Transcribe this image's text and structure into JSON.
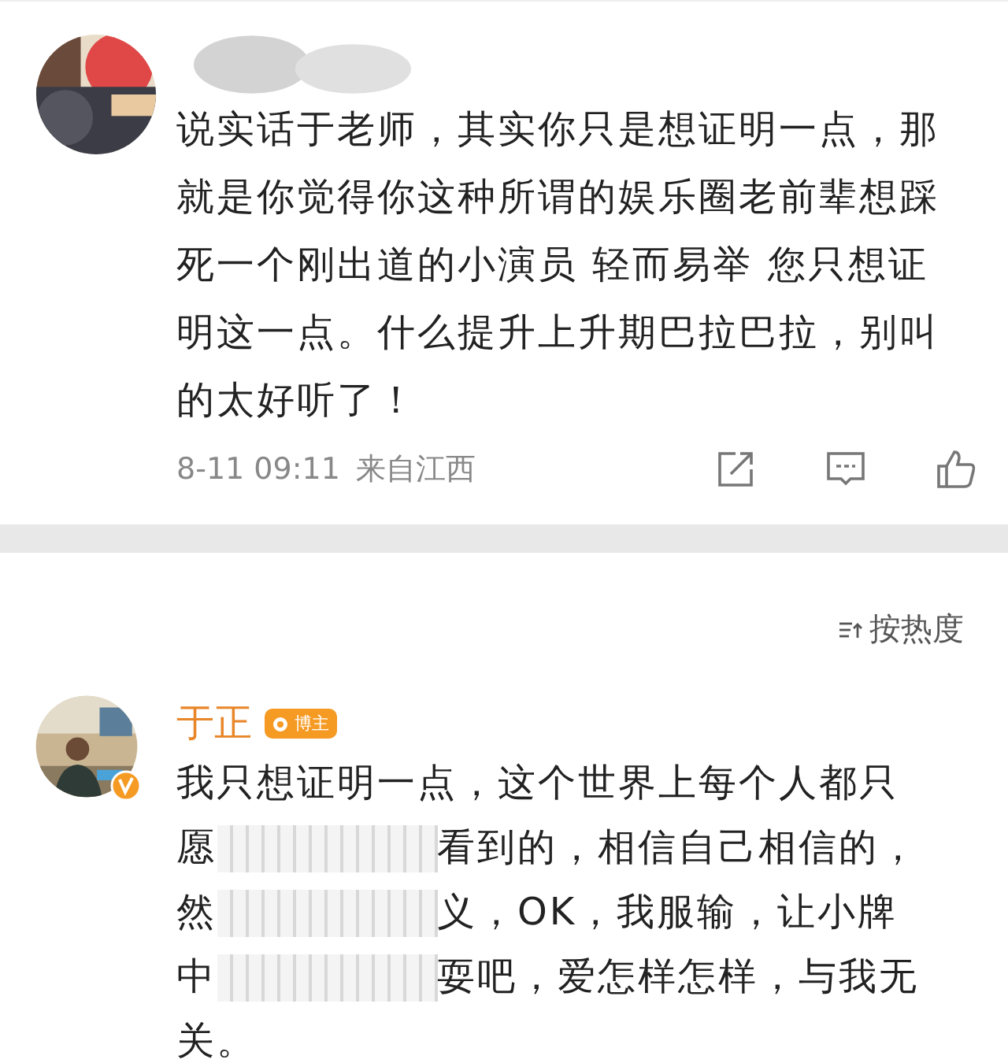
{
  "comments": [
    {
      "author_hidden": true,
      "verified": false,
      "lines": [
        {
          "parts": [
            "说实话于老师，其实你只是想证明一点，那"
          ]
        },
        {
          "parts": [
            "就是你觉得你这种所谓的娱乐圈老前辈想踩"
          ]
        },
        {
          "parts": [
            "死一个刚出道的小演员 轻而易举 您只想证"
          ]
        },
        {
          "parts": [
            "明这一点。什么提升上升期巴拉巴拉，别叫"
          ]
        },
        {
          "parts": [
            "的太好听了！"
          ]
        }
      ],
      "time": "8-11 09:11",
      "location": "来自江西"
    },
    {
      "author": "于正",
      "author_hidden": false,
      "badge": "博主",
      "verified": true,
      "lines": [
        {
          "parts": [
            "我只想证明一点，这个世界上每个人都只"
          ]
        },
        {
          "parts": [
            "愿",
            "看到的，相信自己相信的，"
          ]
        },
        {
          "parts": [
            "然",
            "义，OK，我服输，让小牌"
          ]
        },
        {
          "parts": [
            "中",
            "耍吧，爱怎样怎样，与我无"
          ]
        },
        {
          "parts": [
            "关。"
          ]
        }
      ]
    }
  ],
  "sort": {
    "label": "按热度"
  }
}
